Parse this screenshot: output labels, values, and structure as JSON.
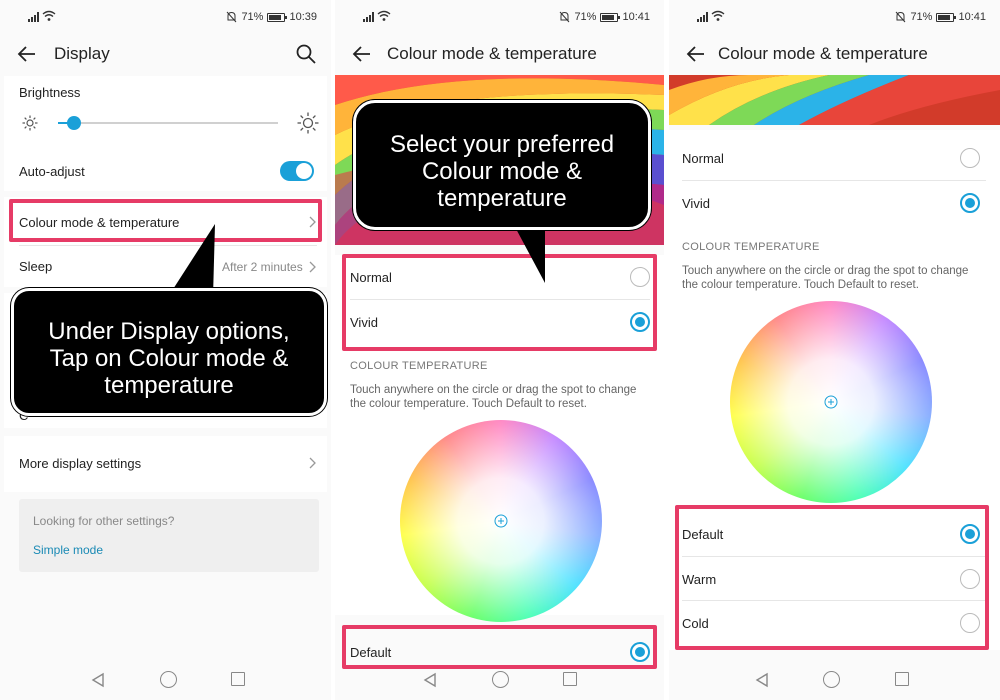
{
  "status": {
    "screen1": {
      "battery": "71%",
      "time": "10:39"
    },
    "screen2": {
      "battery": "71%",
      "time": "10:41"
    },
    "screen3": {
      "battery": "71%",
      "time": "10:41"
    }
  },
  "screen1": {
    "title": "Display",
    "brightness_label": "Brightness",
    "brightness_level": 0.07,
    "auto_adjust_label": "Auto-adjust",
    "auto_adjust_on": true,
    "colour_mode_label": "Colour mode & temperature",
    "sleep_label": "Sleep",
    "sleep_value": "After 2 minutes",
    "more_display_label": "More display settings",
    "other_settings_text": "Looking for other settings?",
    "simple_mode_link": "Simple mode",
    "callout": "Under Display options,\nTap on Colour mode &\ntemperature",
    "hidden_fragment": "C"
  },
  "screen2": {
    "title": "Colour mode & temperature",
    "modes": [
      {
        "label": "Normal",
        "selected": false
      },
      {
        "label": "Vivid",
        "selected": true
      }
    ],
    "section_head": "COLOUR TEMPERATURE",
    "description": "Touch anywhere on the circle or drag the spot to change\nthe colour temperature. Touch Default to reset.",
    "temps": [
      {
        "label": "Default",
        "selected": true
      }
    ],
    "callout": "Select your preferred\nColour mode &\ntemperature"
  },
  "screen3": {
    "title": "Colour mode & temperature",
    "modes": [
      {
        "label": "Normal",
        "selected": false
      },
      {
        "label": "Vivid",
        "selected": true
      }
    ],
    "section_head": "COLOUR TEMPERATURE",
    "description": "Touch anywhere on the circle or drag the spot to change\nthe colour temperature. Touch Default to reset.",
    "temps": [
      {
        "label": "Default",
        "selected": true
      },
      {
        "label": "Warm",
        "selected": false
      },
      {
        "label": "Cold",
        "selected": false
      }
    ]
  },
  "colors": {
    "accent": "#1aa0d8",
    "highlight": "#e63b66",
    "callout_bg": "#000000"
  },
  "icons": [
    "signal-icon",
    "wifi-icon",
    "mute-icon",
    "battery-icon",
    "back-arrow-icon",
    "search-icon",
    "sun-small-icon",
    "sun-large-icon",
    "chevron-right-icon",
    "nav-back-icon",
    "nav-home-icon",
    "nav-recent-icon"
  ]
}
